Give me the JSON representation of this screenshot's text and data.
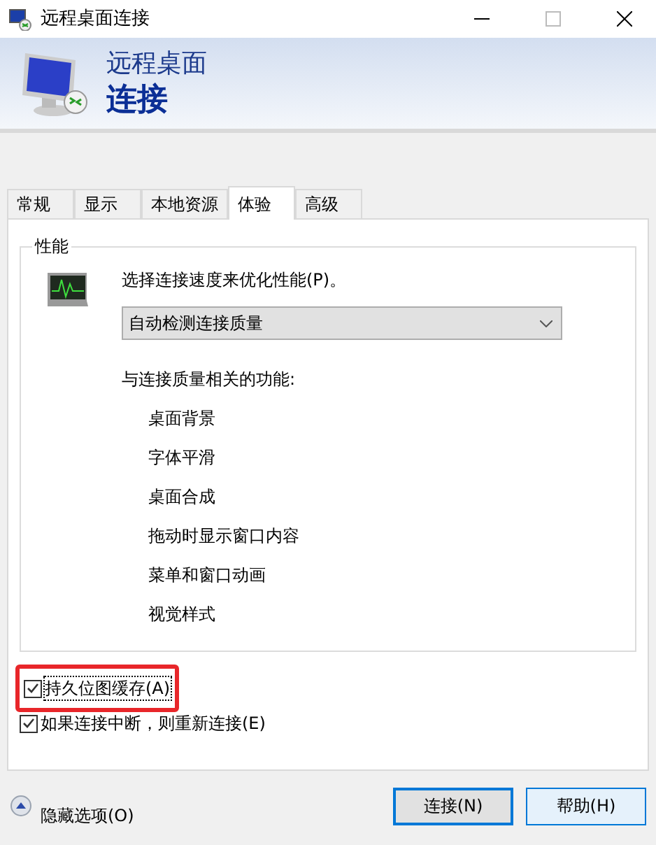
{
  "window": {
    "title": "远程桌面连接"
  },
  "header": {
    "line1": "远程桌面",
    "line2": "连接"
  },
  "tabs": [
    {
      "label": "常规",
      "selected": false
    },
    {
      "label": "显示",
      "selected": false
    },
    {
      "label": "本地资源",
      "selected": false
    },
    {
      "label": "体验",
      "selected": true
    },
    {
      "label": "高级",
      "selected": false
    }
  ],
  "performance": {
    "title": "性能",
    "prompt": "选择连接速度来优化性能(P)。",
    "dropdown": {
      "value": "自动检测连接质量"
    },
    "features_label": "与连接质量相关的功能:",
    "features": [
      "桌面背景",
      "字体平滑",
      "桌面合成",
      "拖动时显示窗口内容",
      "菜单和窗口动画",
      "视觉样式"
    ]
  },
  "checkboxes": [
    {
      "label": "持久位图缓存(A)",
      "checked": true,
      "highlighted": true
    },
    {
      "label": "如果连接中断，则重新连接(E)",
      "checked": true,
      "highlighted": false
    }
  ],
  "options_toggle": {
    "label": "隐藏选项(O)"
  },
  "buttons": [
    {
      "label": "连接(N)",
      "selected": true
    },
    {
      "label": "帮助(H)",
      "selected": false
    }
  ]
}
